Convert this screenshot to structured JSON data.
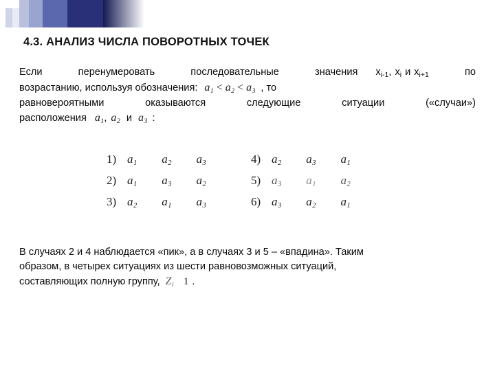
{
  "slide": {
    "title": "4.3. АНАЛИЗ ЧИСЛА ПОВОРОТНЫХ ТОЧЕК",
    "top_paragraph": {
      "line1_a": "Если",
      "line1_b": "перенумеровать",
      "line1_c": "последовательные",
      "line1_d": "значения",
      "line1_x1": "x",
      "line1_x1_sub": "i-1",
      "line1_comma1": ",",
      "line1_x2": "x",
      "line1_x2_sub": "i",
      "line1_and": "и",
      "line1_x3": "x",
      "line1_x3_sub": "i+1",
      "line1_end": "по",
      "line2_a": "возрастанию, используя обозначения:",
      "line2_formula": "a₁ < a₂ < a₃",
      "line2_end": ", то",
      "line3_a": "равновероятными",
      "line3_b": "оказываются",
      "line3_c": "следующие",
      "line3_d": "ситуации",
      "line3_e": "(«случаи»)",
      "line4_a": "расположения",
      "line4_formula1": "a₁",
      "line4_comma": ",",
      "line4_formula2": "a₂",
      "line4_and": "и",
      "line4_formula3": "a₃",
      "line4_end": ":"
    },
    "cases": [
      {
        "number": "1)",
        "terms": [
          "a1",
          "a2",
          "a3"
        ]
      },
      {
        "number": "2)",
        "terms": [
          "a1",
          "a3",
          "a2"
        ]
      },
      {
        "number": "3)",
        "terms": [
          "a2",
          "a1",
          "a3"
        ]
      },
      {
        "number": "4)",
        "terms": [
          "a2",
          "a3",
          "a1"
        ]
      },
      {
        "number": "5)",
        "terms": [
          "a3",
          "a1",
          "a2"
        ]
      },
      {
        "number": "6)",
        "terms": [
          "a3",
          "a2",
          "a1"
        ]
      }
    ],
    "cases_display": [
      {
        "number": "1)",
        "t1": "a",
        "s1": "1",
        "t2": "a",
        "s2": "2",
        "t3": "a",
        "s3": "3"
      },
      {
        "number": "2)",
        "t1": "a",
        "s1": "1",
        "t2": "a",
        "s2": "3",
        "t3": "a",
        "s3": "2"
      },
      {
        "number": "3)",
        "t1": "a",
        "s1": "2",
        "t2": "a",
        "s2": "1",
        "t3": "a",
        "s3": "3"
      },
      {
        "number": "4)",
        "t1": "a",
        "s1": "2",
        "t2": "a",
        "s2": "3",
        "t3": "a",
        "s3": "1"
      },
      {
        "number": "5)",
        "t1": "a",
        "s1": "3",
        "t2": "a",
        "s2": "1",
        "t3": "a",
        "s3": "2"
      },
      {
        "number": "6)",
        "t1": "a",
        "s1": "3",
        "t2": "a",
        "s2": "2",
        "t3": "a",
        "s3": "1"
      }
    ],
    "bottom_paragraph": {
      "line1": "В случаях 2 и 4 наблюдается «пик», а в случаях 3 и 5 – «впадина». Таким",
      "line2": "образом, в четырех ситуациях из шести равновозможных ситуаций,",
      "line3_a": "составляющих полную группу,",
      "line3_formula_z": "Z",
      "line3_formula_sub": "i",
      "line3_formula_one": "1",
      "line3_end": "."
    }
  }
}
